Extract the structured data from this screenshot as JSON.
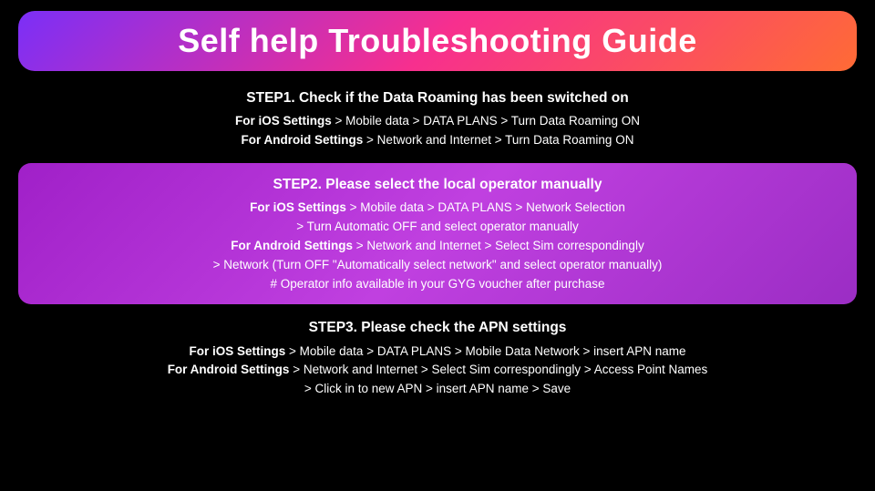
{
  "title": "Self help Troubleshooting Guide",
  "steps": [
    {
      "id": "step1",
      "highlighted": false,
      "title": "STEP1. Check if the Data Roaming has been switched on",
      "lines": [
        {
          "parts": [
            {
              "text": "For iOS Settings",
              "bold": true
            },
            {
              "text": " > Mobile data > DATA PLANS > Turn Data Roaming ON",
              "bold": false
            }
          ]
        },
        {
          "parts": [
            {
              "text": "For Android Settings",
              "bold": true
            },
            {
              "text": " > Network and Internet > Turn Data Roaming ON",
              "bold": false
            }
          ]
        }
      ]
    },
    {
      "id": "step2",
      "highlighted": true,
      "title": "STEP2. Please select the local operator manually",
      "lines": [
        {
          "parts": [
            {
              "text": "For iOS Settings",
              "bold": true
            },
            {
              "text": " > Mobile data > DATA PLANS > Network Selection",
              "bold": false
            }
          ]
        },
        {
          "parts": [
            {
              "text": "> Turn Automatic OFF and select operator manually",
              "bold": false
            }
          ]
        },
        {
          "parts": [
            {
              "text": "For Android Settings",
              "bold": true
            },
            {
              "text": " > Network and Internet > Select Sim correspondingly",
              "bold": false
            }
          ]
        },
        {
          "parts": [
            {
              "text": "> Network (Turn OFF \"Automatically select network\" and select operator manually)",
              "bold": false
            }
          ]
        },
        {
          "parts": [
            {
              "text": "# Operator info available in your GYG voucher after purchase",
              "bold": false
            }
          ]
        }
      ]
    },
    {
      "id": "step3",
      "highlighted": false,
      "title": "STEP3. Please check the APN settings",
      "lines": [
        {
          "parts": [
            {
              "text": "For iOS Settings",
              "bold": true
            },
            {
              "text": " > Mobile data > DATA PLANS > Mobile Data Network > insert APN name",
              "bold": false
            }
          ]
        },
        {
          "parts": [
            {
              "text": "For Android Settings",
              "bold": true
            },
            {
              "text": " > Network and Internet > Select Sim correspondingly > Access Point Names",
              "bold": false
            }
          ]
        },
        {
          "parts": [
            {
              "text": "> Click in to new APN > insert APN name > Save",
              "bold": false
            }
          ]
        }
      ]
    }
  ]
}
